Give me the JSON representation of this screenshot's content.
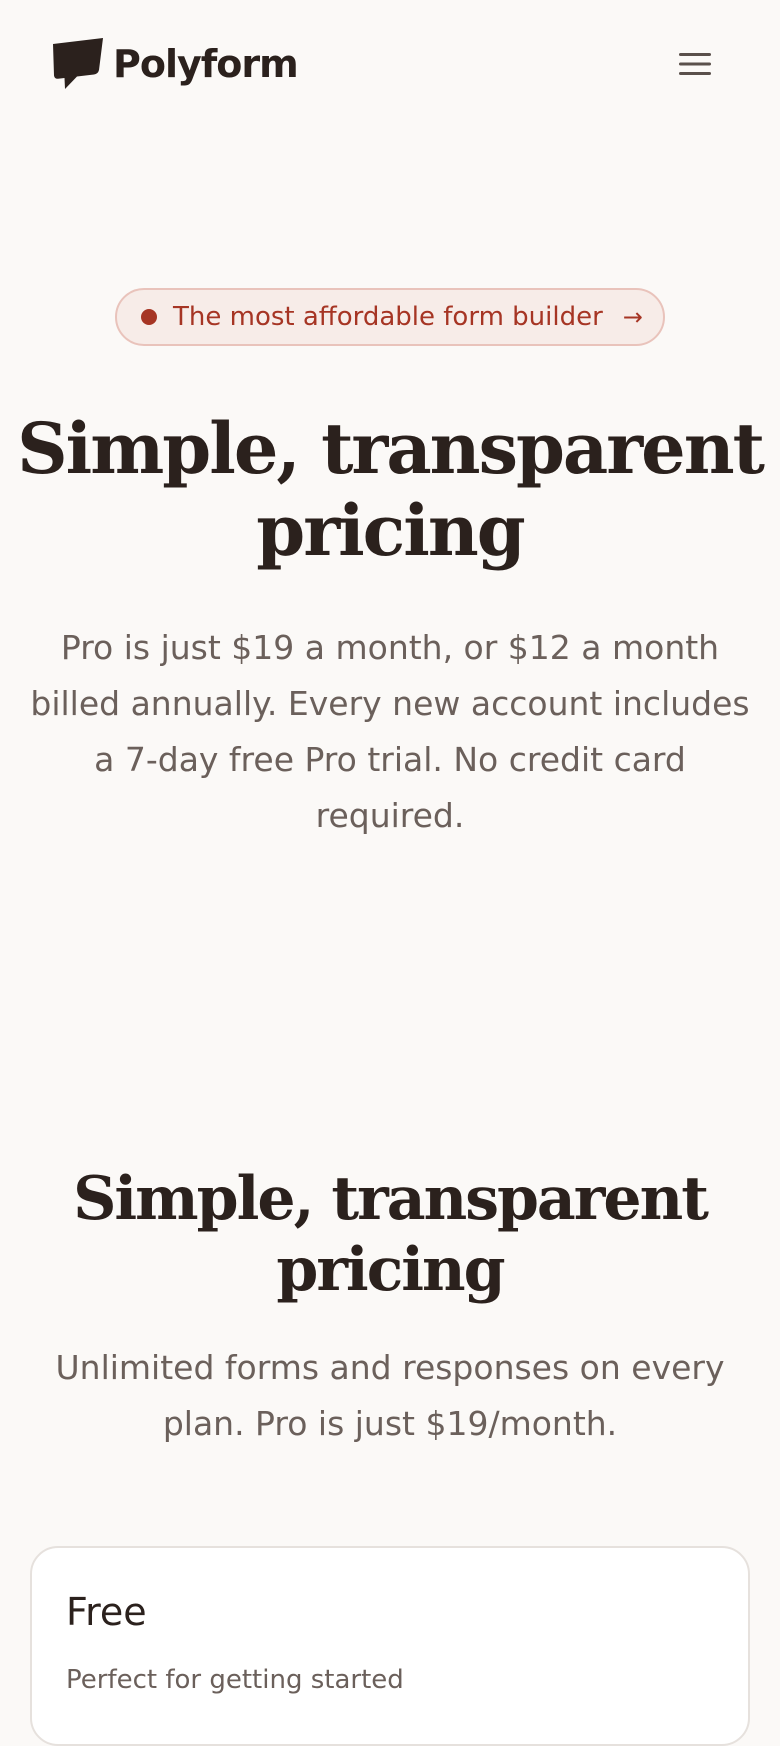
{
  "header": {
    "brand_name": "Polyform",
    "menu_icon": "hamburger-menu-icon",
    "logo_icon": "speech-bubble-logo-icon"
  },
  "hero": {
    "badge_text": "The most affordable form builder",
    "badge_arrow": "→",
    "title": "Simple, transparent pricing",
    "subtitle": "Pro is just $19 a month, or $12 a month billed annually. Every new account includes a 7-day free Pro trial. No credit card required."
  },
  "pricing": {
    "title": "Simple, transparent pricing",
    "subtitle": "Unlimited forms and responses on every plan. Pro is just $19/month.",
    "plans": [
      {
        "name": "Free",
        "description": "Perfect for getting started"
      }
    ]
  },
  "colors": {
    "background": "#fbf9f7",
    "text_dark": "#2b211d",
    "text_muted": "#6b605b",
    "accent": "#a63524",
    "badge_bg": "#f7ece8",
    "badge_border": "#e9c3bb",
    "card_border": "#e6e1dd"
  }
}
